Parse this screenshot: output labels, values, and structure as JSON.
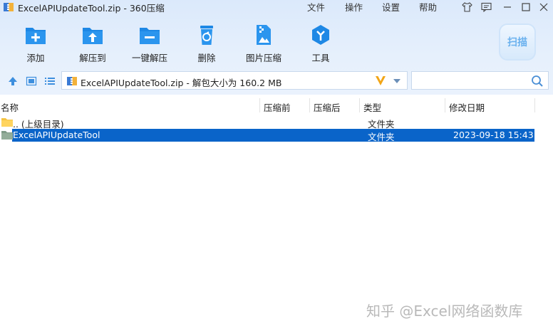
{
  "window": {
    "title": "ExcelAPIUpdateTool.zip - 360压缩",
    "menu": [
      "文件",
      "操作",
      "设置",
      "帮助"
    ]
  },
  "toolbar": {
    "items": [
      {
        "label": "添加",
        "icon": "add-icon"
      },
      {
        "label": "解压到",
        "icon": "extract-to-icon"
      },
      {
        "label": "一键解压",
        "icon": "one-click-extract-icon"
      },
      {
        "label": "删除",
        "icon": "delete-icon"
      },
      {
        "label": "图片压缩",
        "icon": "image-compress-icon"
      },
      {
        "label": "工具",
        "icon": "tools-icon"
      }
    ],
    "scan_label": "扫描"
  },
  "address": {
    "path": "ExcelAPIUpdateTool.zip - 解包大小为 160.2 MB"
  },
  "columns": [
    "名称",
    "压缩前",
    "压缩后",
    "类型",
    "修改日期"
  ],
  "rows": [
    {
      "name": ".. (上级目录)",
      "type": "文件夹",
      "date": ""
    },
    {
      "name": "ExcelAPIUpdateTool",
      "type": "文件夹",
      "date": "2023-09-18 15:43"
    }
  ],
  "watermark": "知乎 @Excel网络函数库",
  "colors": {
    "accent": "#1e88e5",
    "selection": "#0a64c9"
  }
}
